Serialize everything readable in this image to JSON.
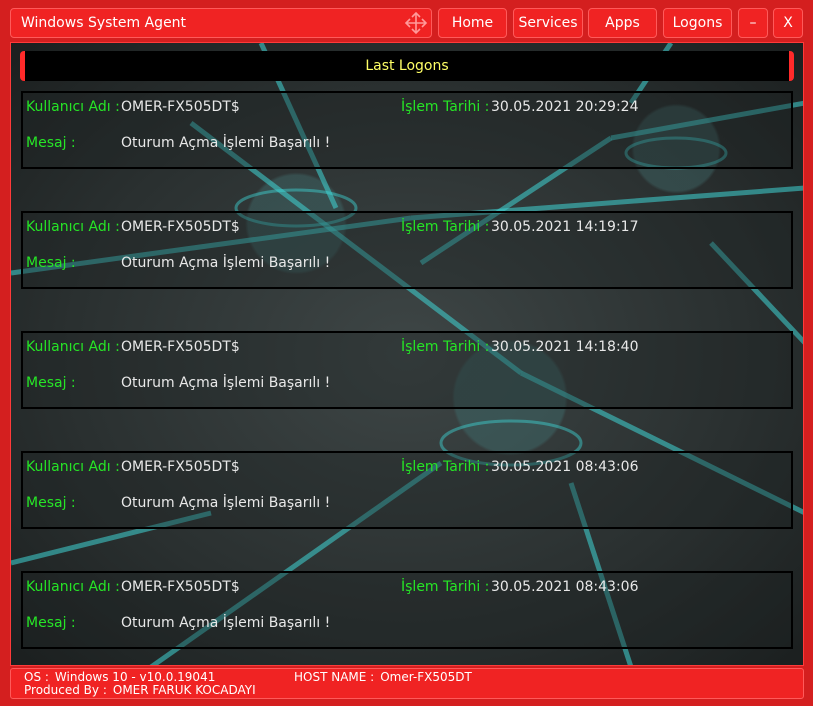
{
  "window": {
    "title": "Windows System Agent",
    "move_icon": "move-arrows-icon"
  },
  "nav": {
    "home": "Home",
    "services": "Services",
    "apps": "Apps",
    "logons": "Logons",
    "minimize": "–",
    "close": "X"
  },
  "section": {
    "title": "Last Logons"
  },
  "labels": {
    "username": "Kullanıcı Adı :",
    "date": "İşlem Tarihi :",
    "message": "Mesaj :"
  },
  "logons": [
    {
      "username": "OMER-FX505DT$",
      "date": "30.05.2021 20:29:24",
      "message": "Oturum Açma İşlemi Başarılı !"
    },
    {
      "username": "OMER-FX505DT$",
      "date": "30.05.2021 14:19:17",
      "message": "Oturum Açma İşlemi Başarılı !"
    },
    {
      "username": "OMER-FX505DT$",
      "date": "30.05.2021 14:18:40",
      "message": "Oturum Açma İşlemi Başarılı !"
    },
    {
      "username": "OMER-FX505DT$",
      "date": "30.05.2021 08:43:06",
      "message": "Oturum Açma İşlemi Başarılı !"
    },
    {
      "username": "OMER-FX505DT$",
      "date": "30.05.2021 08:43:06",
      "message": "Oturum Açma İşlemi Başarılı !"
    }
  ],
  "footer": {
    "os_label": "OS :",
    "os_value": "Windows 10  -  v10.0.19041",
    "host_label": "HOST NAME :",
    "host_value": "Omer-FX505DT",
    "produced_label": "Produced By :",
    "produced_value": "OMER FARUK KOCADAYI"
  },
  "colors": {
    "accent": "#f02323",
    "label_green": "#26e526",
    "header_yellow": "#ffff66",
    "network_cyan": "#3fd6d6"
  }
}
